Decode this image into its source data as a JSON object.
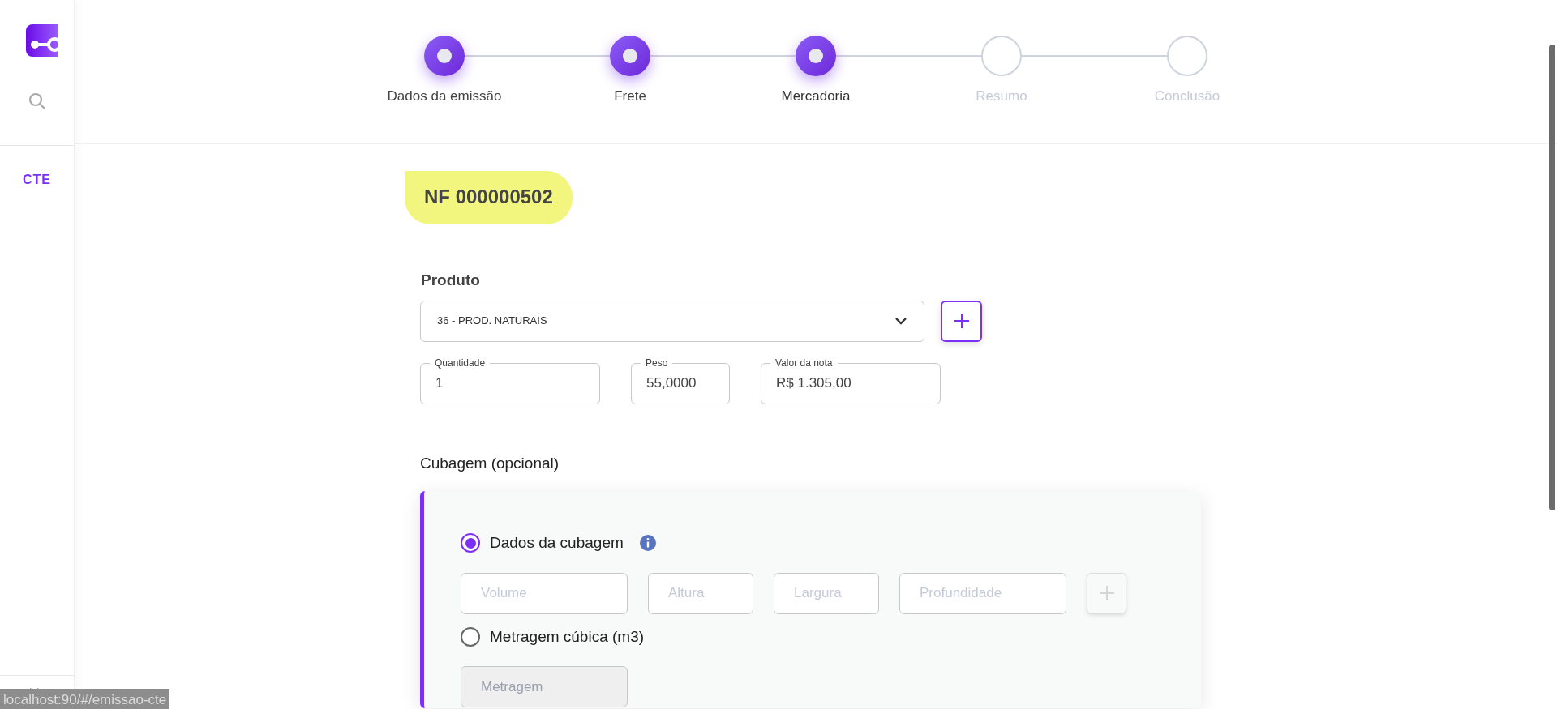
{
  "sidebar": {
    "nav_items": [
      {
        "label": "CTE",
        "selected": true
      }
    ]
  },
  "stepper": {
    "steps": [
      {
        "label": "Dados da emissão",
        "completed": true,
        "selected": false
      },
      {
        "label": "Frete",
        "completed": true,
        "selected": false
      },
      {
        "label": "Mercadoria",
        "completed": true,
        "selected": true
      },
      {
        "label": "Resumo",
        "completed": false,
        "selected": false
      },
      {
        "label": "Conclusão",
        "completed": false,
        "selected": false
      }
    ]
  },
  "invoice_badge": "NF 000000502",
  "product": {
    "label": "Produto",
    "select": {
      "value": "36 - PROD. NATURAIS"
    },
    "fields": [
      {
        "label": "Quantidade",
        "value": "1"
      },
      {
        "label": "Peso",
        "value": "55,0000"
      },
      {
        "label": "Valor da nota",
        "value": "R$ 1.305,00"
      }
    ]
  },
  "cubagem": {
    "title": "Cubagem (opcional)",
    "options": [
      {
        "label": "Dados da cubagem",
        "selected": true,
        "info": true,
        "add_button": {
          "disabled": true
        },
        "fields": [
          {
            "placeholder": "Volume"
          },
          {
            "placeholder": "Altura"
          },
          {
            "placeholder": "Largura"
          },
          {
            "placeholder": "Profundidade"
          }
        ]
      },
      {
        "label": "Metragem cúbica (m3)",
        "selected": false,
        "fields": [
          {
            "placeholder": "Metragem"
          }
        ]
      }
    ]
  },
  "status_bar": {
    "url": "localhost:90/#/emissao-cte"
  }
}
